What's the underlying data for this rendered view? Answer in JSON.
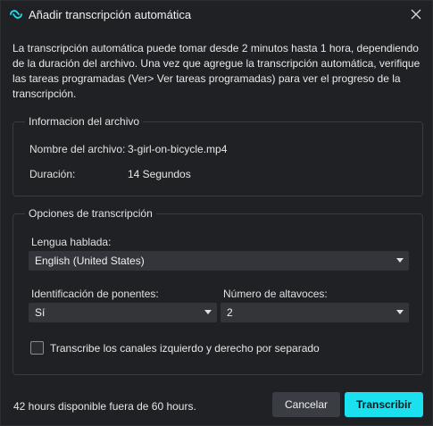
{
  "window": {
    "title": "Añadir transcripción automática",
    "icon": "sync-loop-icon",
    "accent_color": "#1ae0f0"
  },
  "intro_text": "La transcripción automática puede tomar desde 2 minutos hasta 1 hora, dependiendo de la duración del archivo. Una vez que agregue la transcripción automática, verifique las tareas programadas (Ver> Ver tareas programadas) para ver el progreso de la transcripción.",
  "file_info": {
    "legend": "Informacion del archivo",
    "name_label": "Nombre del archivo:",
    "name_value": "3-girl-on-bicycle.mp4",
    "duration_label": "Duración:",
    "duration_value": "14 Segundos"
  },
  "options": {
    "legend": "Opciones de transcripción",
    "language_label": "Lengua hablada:",
    "language_value": "English (United States)",
    "speaker_id_label": "Identificación de ponentes:",
    "speaker_id_value": "Sí",
    "speaker_count_label": "Número de altavoces:",
    "speaker_count_value": "2",
    "split_channels_label": "Transcribe los canales izquierdo y derecho por separado",
    "split_channels_checked": false
  },
  "footer": {
    "quota_text": "42 hours disponible fuera de 60 hours.",
    "cancel_label": "Cancelar",
    "transcribe_label": "Transcribir"
  }
}
